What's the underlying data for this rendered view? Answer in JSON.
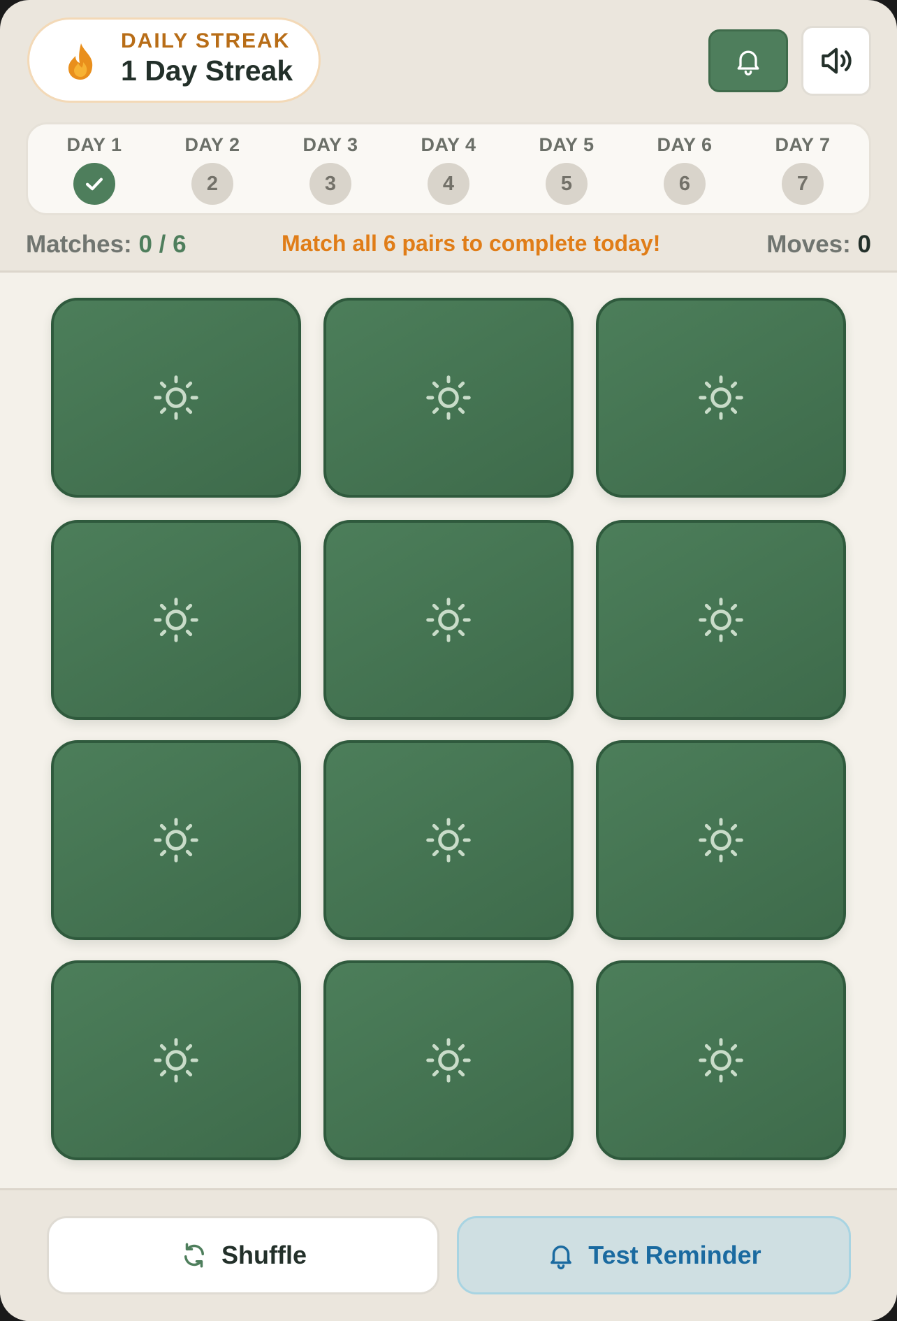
{
  "header": {
    "streak_kicker": "DAILY STREAK",
    "streak_title": "1 Day Streak",
    "icons": {
      "streak": "flame-icon",
      "notifications": "bell-icon",
      "sound": "speaker-icon"
    }
  },
  "days": [
    {
      "label": "DAY 1",
      "number": "",
      "completed": true
    },
    {
      "label": "DAY 2",
      "number": "2",
      "completed": false
    },
    {
      "label": "DAY 3",
      "number": "3",
      "completed": false
    },
    {
      "label": "DAY 4",
      "number": "4",
      "completed": false
    },
    {
      "label": "DAY 5",
      "number": "5",
      "completed": false
    },
    {
      "label": "DAY 6",
      "number": "6",
      "completed": false
    },
    {
      "label": "DAY 7",
      "number": "7",
      "completed": false
    }
  ],
  "status": {
    "matches_label": "Matches:",
    "matches_value": "0 / 6",
    "hint": "Match all 6 pairs to complete today!",
    "moves_label": "Moves:",
    "moves_value": "0"
  },
  "board": {
    "rows": 4,
    "cols": 3,
    "card_back_icon": "sun-icon",
    "cards_face_down": 12
  },
  "footer": {
    "shuffle_label": "Shuffle",
    "reminder_label": "Test Reminder"
  },
  "colors": {
    "accent_green": "#4e7e5c",
    "streak_orange": "#e07d18",
    "reminder_blue": "#1a6aa0"
  }
}
